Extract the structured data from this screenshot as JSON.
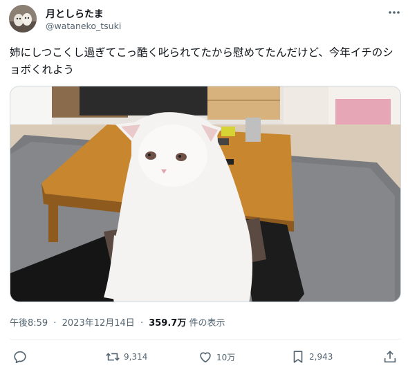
{
  "author": {
    "display_name": "月としらたま",
    "handle": "@wataneko_tsuki"
  },
  "tweet": {
    "text": "姉にしつこくし過ぎてこっ酷く叱られてたから慰めてたんだけど、今年イチのショボくれよう"
  },
  "meta": {
    "time": "午後8:59",
    "separator": "·",
    "date": "2023年12月14日",
    "views_count": "359.7万",
    "views_label": " 件の表示"
  },
  "actions": {
    "reply_count": "",
    "retweet_count": "9,314",
    "like_count": "10万",
    "bookmark_count": "2,943"
  },
  "icons": {
    "more": "more-dots-icon",
    "reply": "reply-bubble-icon",
    "retweet": "retweet-icon",
    "like": "heart-icon",
    "bookmark": "bookmark-icon",
    "share": "share-upload-icon"
  },
  "colors": {
    "text_primary": "#0f1419",
    "text_secondary": "#536471",
    "divider": "#eff3f4"
  }
}
